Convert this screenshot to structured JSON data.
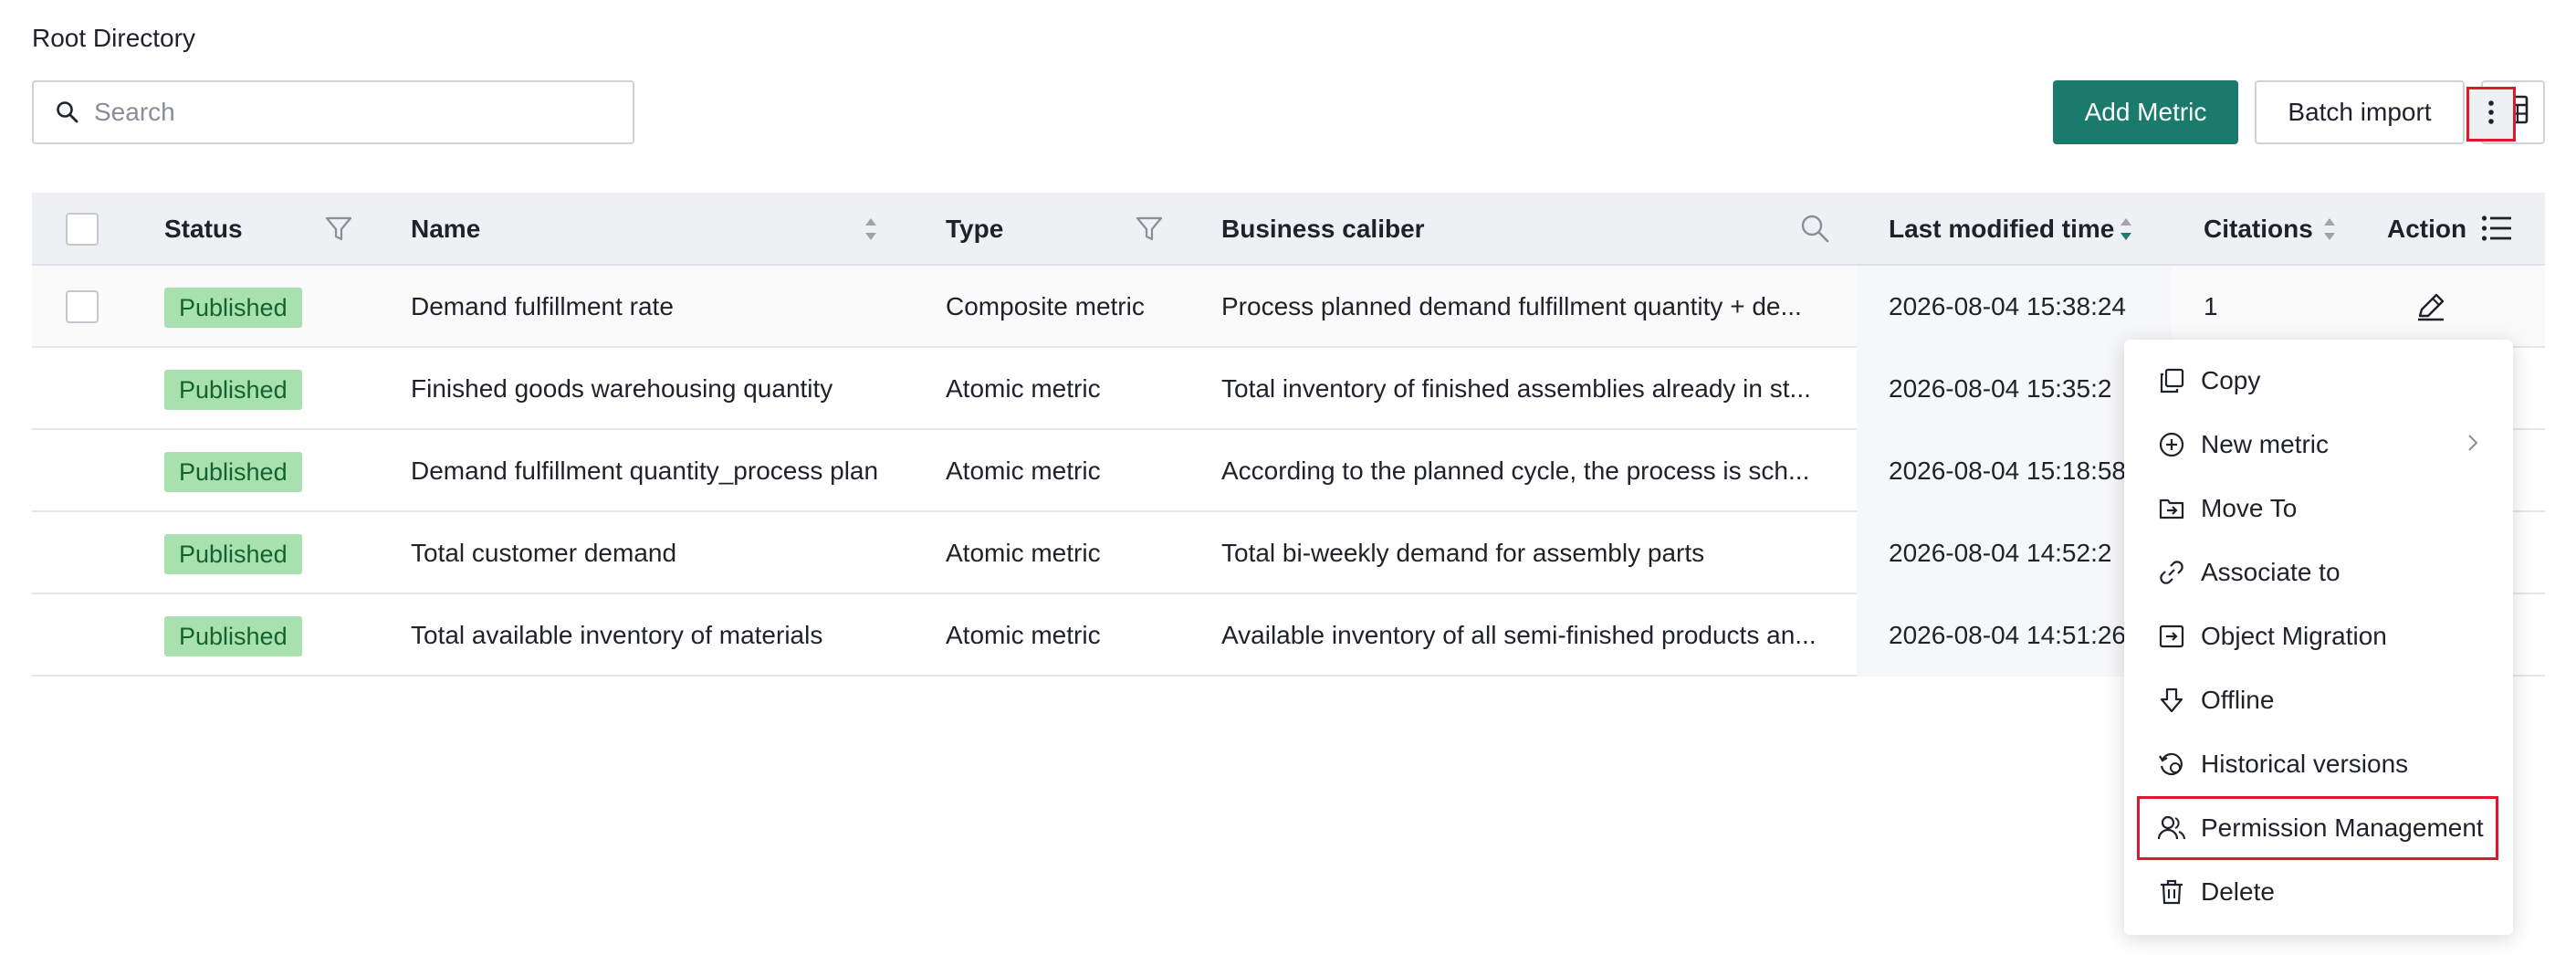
{
  "breadcrumb": "Root Directory",
  "search": {
    "placeholder": "Search"
  },
  "toolbar": {
    "add_metric": "Add Metric",
    "batch_import": "Batch import"
  },
  "colors": {
    "primary": "#1a7a6b",
    "badge_bg": "#a8e0b0",
    "badge_text": "#14632e",
    "highlight": "#e0182c"
  },
  "table": {
    "columns": {
      "status": "Status",
      "name": "Name",
      "type": "Type",
      "business_caliber": "Business caliber",
      "last_modified": "Last modified time",
      "citations": "Citations",
      "action": "Action"
    },
    "rows": [
      {
        "status": "Published",
        "name": "Demand fulfillment rate",
        "type": "Composite metric",
        "business_caliber": "Process planned demand fulfillment quantity + de...",
        "last_modified": "2026-08-04 15:38:24",
        "citations": "1"
      },
      {
        "status": "Published",
        "name": "Finished goods warehousing quantity",
        "type": "Atomic metric",
        "business_caliber": "Total inventory of finished assemblies already in st...",
        "last_modified": "2026-08-04 15:35:2",
        "citations": ""
      },
      {
        "status": "Published",
        "name": "Demand fulfillment quantity_process plan",
        "type": "Atomic metric",
        "business_caliber": "According to the planned cycle, the process is sch...",
        "last_modified": "2026-08-04 15:18:58",
        "citations": ""
      },
      {
        "status": "Published",
        "name": "Total customer demand",
        "type": "Atomic metric",
        "business_caliber": "Total bi-weekly demand for assembly parts",
        "last_modified": "2026-08-04 14:52:2",
        "citations": ""
      },
      {
        "status": "Published",
        "name": "Total available inventory of materials",
        "type": "Atomic metric",
        "business_caliber": "Available inventory of all semi-finished products an...",
        "last_modified": "2026-08-04 14:51:26",
        "citations": ""
      }
    ]
  },
  "context_menu": {
    "items": [
      {
        "label": "Copy",
        "icon": "copy-icon"
      },
      {
        "label": "New metric",
        "icon": "plus-circle-icon",
        "has_submenu": true
      },
      {
        "label": "Move To",
        "icon": "move-to-icon"
      },
      {
        "label": "Associate to",
        "icon": "link-icon"
      },
      {
        "label": "Object Migration",
        "icon": "migration-icon"
      },
      {
        "label": "Offline",
        "icon": "offline-icon"
      },
      {
        "label": "Historical versions",
        "icon": "history-icon"
      },
      {
        "label": "Permission Management",
        "icon": "users-icon",
        "highlighted": true
      },
      {
        "label": "Delete",
        "icon": "trash-icon"
      }
    ]
  }
}
